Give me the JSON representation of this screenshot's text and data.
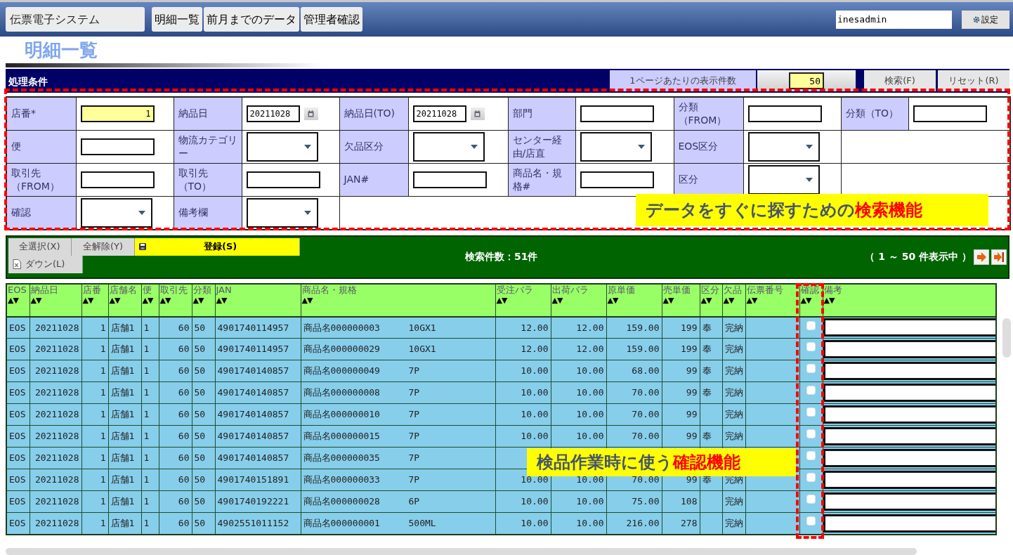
{
  "header": {
    "app_title": "伝票電子システム",
    "nav_tabs": [
      {
        "label": "明細一覧"
      },
      {
        "label": "前月までのデータ"
      },
      {
        "label": "管理者確認"
      }
    ],
    "user": "inesadmin",
    "settings_button": "設定"
  },
  "page_title": "明細一覧",
  "conditions": {
    "title": "処理条件",
    "per_page_label": "1ページあたりの表示件数",
    "per_page_value": "50",
    "buttons": [
      "検索(F)",
      "リセット(R)"
    ],
    "rows": [
      {
        "fields": [
          {
            "label": "店番*",
            "kind": "text",
            "value": "1",
            "highlighted": true
          },
          {
            "label": "納品日",
            "kind": "date",
            "value": "20211028",
            "highlighted": false
          },
          {
            "label": "納品日(TO)",
            "kind": "date",
            "value": "20211028",
            "highlighted": false
          },
          {
            "label": "部門",
            "kind": "text",
            "highlighted": false
          },
          {
            "label": "分類（FROM）",
            "kind": "text",
            "highlighted": false
          },
          {
            "label": "分類（TO）",
            "kind": "text",
            "highlighted": false
          }
        ]
      },
      {
        "fields": [
          {
            "label": "便",
            "kind": "text",
            "highlighted": false
          },
          {
            "label": "物流カテゴリー",
            "kind": "select",
            "highlighted": false
          },
          {
            "label": "欠品区分",
            "kind": "select",
            "highlighted": false
          },
          {
            "label": "センター経由/店直",
            "kind": "select",
            "highlighted": false
          },
          {
            "label": "EOS区分",
            "kind": "select",
            "highlighted": false
          }
        ]
      },
      {
        "fields": [
          {
            "label": "取引先（FROM）",
            "kind": "text",
            "highlighted": false
          },
          {
            "label": "取引先（TO）",
            "kind": "text",
            "highlighted": false
          },
          {
            "label": "JAN#",
            "kind": "text",
            "highlighted": false
          },
          {
            "label": "商品名・規格#",
            "kind": "text",
            "highlighted": false
          },
          {
            "label": "区分",
            "kind": "select",
            "highlighted": false
          }
        ]
      },
      {
        "fields": [
          {
            "label": "確認",
            "kind": "select",
            "highlighted": false
          },
          {
            "label": "備考欄",
            "kind": "select",
            "highlighted": false
          }
        ]
      }
    ]
  },
  "toolbar": {
    "buttons": [
      {
        "label": "全選択(X)",
        "kind": "plain"
      },
      {
        "label": "全解除(Y)",
        "kind": "plain"
      },
      {
        "label": "登録(S)",
        "kind": "primary"
      },
      {
        "label": "ダウン(L)",
        "kind": "download"
      }
    ],
    "count": "検索件数：51件",
    "range": "（ 1 ～ 50 件表示中 ）"
  },
  "table": {
    "columns": [
      {
        "label": "EOS",
        "sort": "▲▼",
        "kind": "text"
      },
      {
        "label": "納品日",
        "sort": "▲▼",
        "kind": "number"
      },
      {
        "label": "店番",
        "sort": "▲▼",
        "kind": "number"
      },
      {
        "label": "店舗名",
        "sort": "▲▼",
        "kind": "text"
      },
      {
        "label": "便",
        "sort": "▲▼",
        "kind": "text"
      },
      {
        "label": "取引先",
        "sort": "▲▼",
        "kind": "number"
      },
      {
        "label": "分類",
        "sort": "▲▼",
        "kind": "text"
      },
      {
        "label": "JAN",
        "sort": "▲▼",
        "kind": "text"
      },
      {
        "label": "商品名・規格",
        "sort": "▲▼",
        "kind": "product"
      },
      {
        "label": "受注バラ",
        "sort": "▲▼",
        "kind": "number"
      },
      {
        "label": "出荷バラ",
        "sort": "▲▼",
        "kind": "number"
      },
      {
        "label": "原単価",
        "sort": "▲▼",
        "kind": "number"
      },
      {
        "label": "売単価",
        "sort": "▲▼",
        "kind": "number"
      },
      {
        "label": "区分",
        "sort": "▲▼",
        "kind": "text"
      },
      {
        "label": "欠品",
        "sort": "▲▼",
        "kind": "text"
      },
      {
        "label": "伝票番号",
        "sort": "▲▼",
        "kind": "text"
      },
      {
        "label": "確認",
        "sort": "▲▼",
        "kind": "checkbox"
      },
      {
        "label": "備考",
        "sort": "▲▼",
        "kind": "field"
      }
    ],
    "rows": [
      {
        "cells": [
          "EOS",
          "20211028",
          "1",
          "店舗1",
          "1",
          "60",
          "50",
          "4901740114957",
          {
            "name": "商品名000000003",
            "spec": "10GX1"
          },
          "12.00",
          "12.00",
          "159.00",
          "199",
          "奉",
          "完納",
          null
        ],
        "checked": false
      },
      {
        "cells": [
          "EOS",
          "20211028",
          "1",
          "店舗1",
          "1",
          "60",
          "50",
          "4901740114957",
          {
            "name": "商品名000000029",
            "spec": "10GX1"
          },
          "12.00",
          "12.00",
          "159.00",
          "199",
          "奉",
          "完納",
          null
        ],
        "checked": false
      },
      {
        "cells": [
          "EOS",
          "20211028",
          "1",
          "店舗1",
          "1",
          "60",
          "50",
          "4901740140857",
          {
            "name": "商品名000000049",
            "spec": "7P"
          },
          "10.00",
          "10.00",
          "68.00",
          "99",
          "奉",
          "完納",
          null
        ],
        "checked": false
      },
      {
        "cells": [
          "EOS",
          "20211028",
          "1",
          "店舗1",
          "1",
          "60",
          "50",
          "4901740140857",
          {
            "name": "商品名000000008",
            "spec": "7P"
          },
          "10.00",
          "10.00",
          "70.00",
          "99",
          "奉",
          "完納",
          null
        ],
        "checked": false
      },
      {
        "cells": [
          "EOS",
          "20211028",
          "1",
          "店舗1",
          "1",
          "60",
          "50",
          "4901740140857",
          {
            "name": "商品名000000010",
            "spec": "7P"
          },
          "10.00",
          "10.00",
          "70.00",
          "99",
          null,
          "完納",
          null
        ],
        "checked": false
      },
      {
        "cells": [
          "EOS",
          "20211028",
          "1",
          "店舗1",
          "1",
          "60",
          "50",
          "4901740140857",
          {
            "name": "商品名000000015",
            "spec": "7P"
          },
          "10.00",
          "10.00",
          "70.00",
          "99",
          "奉",
          "完納",
          null
        ],
        "checked": false
      },
      {
        "cells": [
          "EOS",
          "20211028",
          "1",
          "店舗1",
          "1",
          "60",
          "50",
          "4901740140857",
          {
            "name": "商品名000000035",
            "spec": "7P"
          },
          null,
          null,
          null,
          null,
          null,
          null,
          null
        ],
        "checked": false
      },
      {
        "cells": [
          "EOS",
          "20211028",
          "1",
          "店舗1",
          "1",
          "60",
          "50",
          "4901740151891",
          {
            "name": "商品名000000033",
            "spec": "7P"
          },
          "10.00",
          "10.00",
          "70.00",
          "99",
          "奉",
          "完納",
          null
        ],
        "checked": false
      },
      {
        "cells": [
          "EOS",
          "20211028",
          "1",
          "店舗1",
          "1",
          "60",
          "50",
          "4901740192221",
          {
            "name": "商品名000000028",
            "spec": "6P"
          },
          "10.00",
          "10.00",
          "75.00",
          "108",
          null,
          "完納",
          null
        ],
        "checked": false
      },
      {
        "cells": [
          "EOS",
          "20211028",
          "1",
          "店舗1",
          "1",
          "60",
          "50",
          "4902551011152",
          {
            "name": "商品名000000001",
            "spec": "500ML"
          },
          "10.00",
          "10.00",
          "216.00",
          "278",
          null,
          "完納",
          null
        ],
        "checked": false
      }
    ]
  },
  "callouts": [
    {
      "text": "データをすぐに探すための",
      "accent": "検索機能"
    },
    {
      "text": "検品作業時に使う",
      "accent": "確認機能"
    }
  ]
}
